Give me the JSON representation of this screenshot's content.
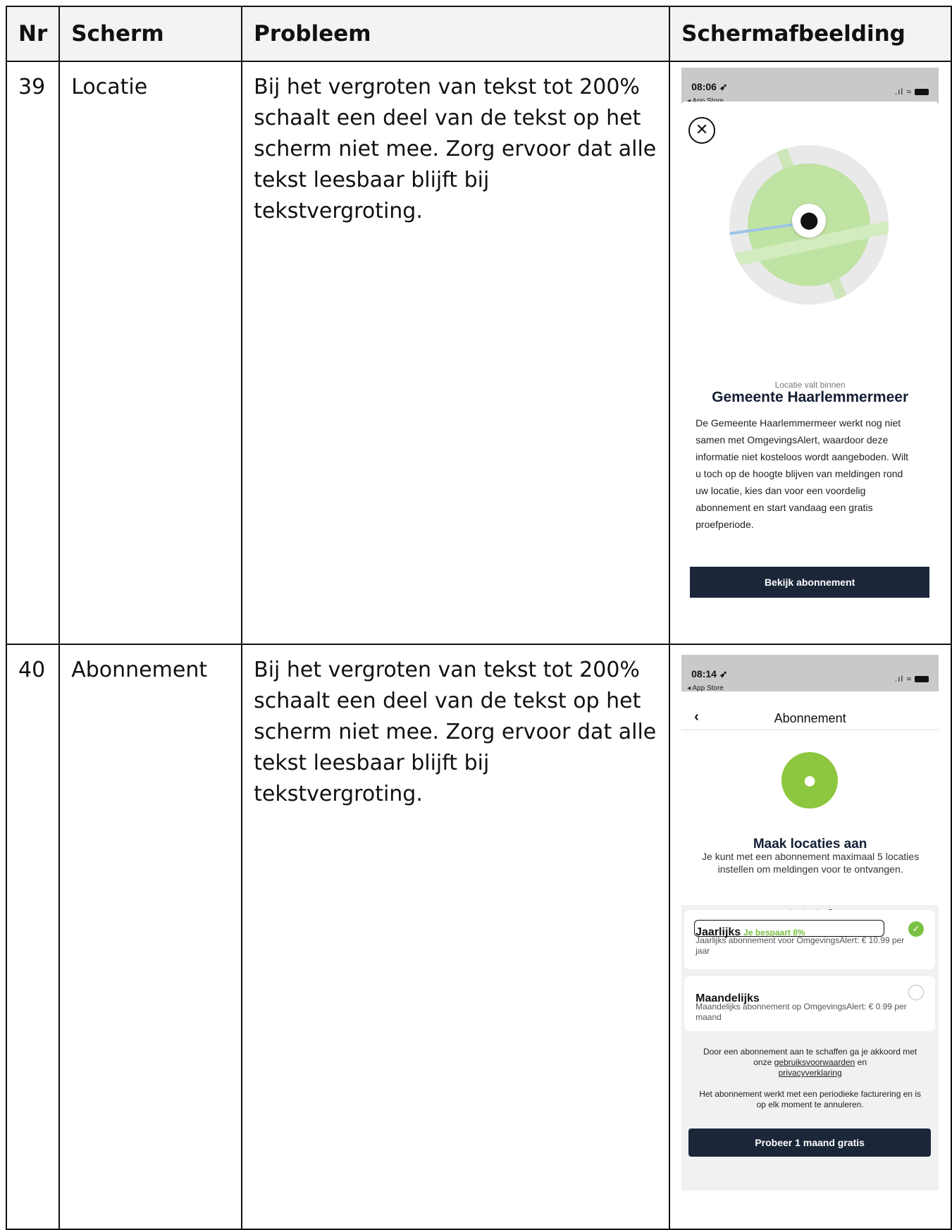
{
  "table": {
    "headers": {
      "nr": "Nr",
      "scherm": "Scherm",
      "probleem": "Probleem",
      "schermafbeelding": "Schermafbeelding"
    },
    "rows": [
      {
        "nr": "39",
        "scherm": "Locatie",
        "probleem": "Bij het vergroten van tekst tot 200% schaalt een deel van de tekst op het scherm niet mee. Zorg ervoor dat alle tekst leesbaar blijft bij tekstvergroting."
      },
      {
        "nr": "40",
        "scherm": "Abonnement",
        "probleem": "Bij het vergroten van tekst tot 200% schaalt een deel van de tekst op het scherm niet mee. Zorg ervoor dat alle tekst leesbaar blijft bij tekstvergroting."
      }
    ]
  },
  "screen39": {
    "time": "08:06",
    "back_app": "◂ App Store",
    "subtitle": "Locatie valt binnen",
    "title": "Gemeente Haarlemmermeer",
    "body": "De Gemeente Haarlemmermeer werkt nog niet samen met OmgevingsAlert, waardoor deze informatie niet kosteloos wordt aangeboden. Wilt u toch op de hoogte blijven van meldingen rond uw locatie, kies dan voor een voordelig abonnement en start vandaag een gratis proefperiode.",
    "button": "Bekijk abonnement"
  },
  "screen40": {
    "time": "08:14",
    "back_app": "◂ App Store",
    "nav_title": "Abonnement",
    "title": "Maak locaties aan",
    "text": "Je kunt met een abonnement maximaal 5 locaties instellen om meldingen voor te ontvangen.",
    "plans": [
      {
        "name": "Jaarlijks",
        "badge": "Je bespaart 8%",
        "desc": "Jaarlijks abonnement voor OmgevingsAlert: € 10.99 per jaar",
        "selected": true
      },
      {
        "name": "Maandelijks",
        "desc": "Maandelijks abonnement op OmgevingsAlert: € 0.99 per maand",
        "selected": false
      }
    ],
    "terms_prefix": "Door een abonnement aan te schaffen ga je akkoord met onze",
    "terms_link1": "gebruiksvoorwaarden",
    "terms_and": "en",
    "terms_link2": "privacyverklaring",
    "billing": "Het abonnement werkt met een periodieke facturering en is op elk moment te annuleren.",
    "button": "Probeer 1 maand gratis"
  },
  "colors": {
    "accent_green": "#8dc63f",
    "navy": "#1b2639"
  },
  "icons": [
    "close-icon",
    "location-pin-icon",
    "chevron-left-icon",
    "check-icon",
    "wifi-icon",
    "signal-icon",
    "battery-icon",
    "location-arrow-icon"
  ]
}
